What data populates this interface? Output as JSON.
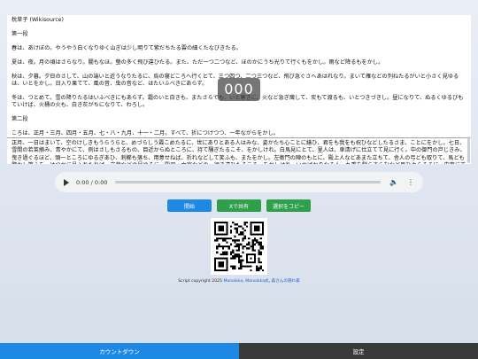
{
  "content": {
    "title": "枕草子 (Wikisource)",
    "section1": "第一段",
    "para_spring": "春は、あけぼの。やうやう白くなりゆく山ぎは少し明りて紫だちたる雲の細くたなびきたる。",
    "para_summer": "夏は、夜。月の頃はさらなり。闇もなほ。螢の多く飛び違ひたる。また、ただ一つ二つなど、ほのかにうち光りて行くもをかし。雨など降るもをかし。",
    "para_autumn": "秋は、夕暮。夕日のさして、山の端いと近うなりたるに、烏の寝どころへ行くとて、三つ四つ、二つ三つなど、飛び急ぐさへあはれなり。まいて雁などの列ねたるがいと小さく見ゆるは、いとをかし。日入り果てて、風の音、虫の音など、はたいふべきにあらず。",
    "para_winter": "冬は、つとめて。雪の降りたるはいふべきにもあらず。霜のいと白きも、またさらでも、いと寒きに、火など急ぎ熾して、炭もて渡るも、いとつきづきし。昼になりて、ぬるくゆるびもていけば、火桶の火も、白き灰がちになりて、わろし。",
    "section2": "第二段",
    "para_months": "ころは、正月・三月、四月・五月、七・八・九月、十一・二月。すべて、折につけつつ、一年ながらをかし。",
    "para_newyear": "正月、一日はまいて、空のけしきもうらうらと、めづらしう霞こめたるに、世にありとある人はみな、姿かたち心ことに繕ひ、君をも我をも祝ひなどしたるさま、ことにをかし。七日、雪間の若菜摘み、青やかにて、例はさしもさるもの、目近からぬところに、持て騒ぎたるこそ、をかしけれ。白馬見にとて、里人は、車清げに仕立てて見に行く。中の御門の戸じきみ、曳き過ぐるほど、頭一ところにゆるぎあひ、刺櫛も落ち、用意せねば、折れなどして笑ふも、またをかし。左衛門の陣のもとに、殿上人などあまた立ちて、舎人の弓ども取りて、馬ども驚かし笑ふを、はつかに見入れたれば、立蔀などの見ゆるに、殿司・女官などの、行き違ひたるこそ、をかしけれ。いかばかりなる人、九重を馴らすらむなど思ひやらるるに、内裏にて見るは、いと狭きほどにて、舎"
  },
  "loader_text": "000",
  "audio": {
    "time": "0:00 / 0:00"
  },
  "buttons": {
    "start": "開始",
    "share_x": "Xで共有",
    "copy_selection": "選択をコピー"
  },
  "credit": {
    "prefix": "Script copyright 2025 ",
    "author1": "Manoikka",
    "sep": ", ",
    "author2": "Manoikka式",
    "sep2": ", ",
    "author3": "森さんの隠れ家"
  },
  "tabs": {
    "countdown": "カウントダウン",
    "settings": "設定"
  },
  "colors": {
    "accent": "#1e88e5",
    "green": "#2ea04a",
    "dark_tab": "#3a3a3a"
  }
}
